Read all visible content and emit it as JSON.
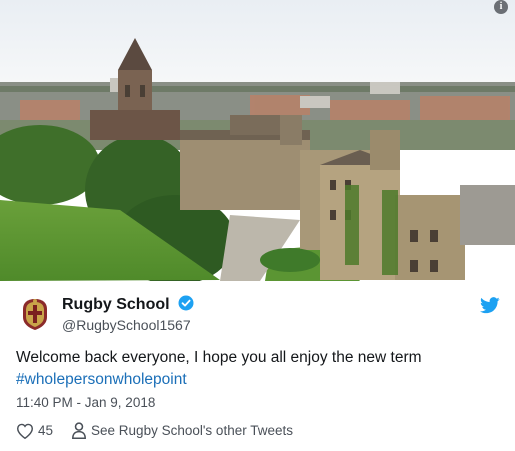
{
  "photo": {
    "alt_icon": "info-icon"
  },
  "account": {
    "display_name": "Rugby School",
    "handle": "@RugbySchool1567",
    "verified": true
  },
  "tweet": {
    "text": "Welcome back everyone, I hope you all enjoy the new term",
    "hashtag": "#wholepersonwholepoint",
    "timestamp": "11:40 PM - Jan 9, 2018"
  },
  "actions": {
    "like_count": "45",
    "profile_link": "See Rugby School's other Tweets"
  },
  "colors": {
    "twitter_blue": "#1da1f2",
    "hashtag": "#1b6fb8",
    "verified": "#1da1f2"
  }
}
